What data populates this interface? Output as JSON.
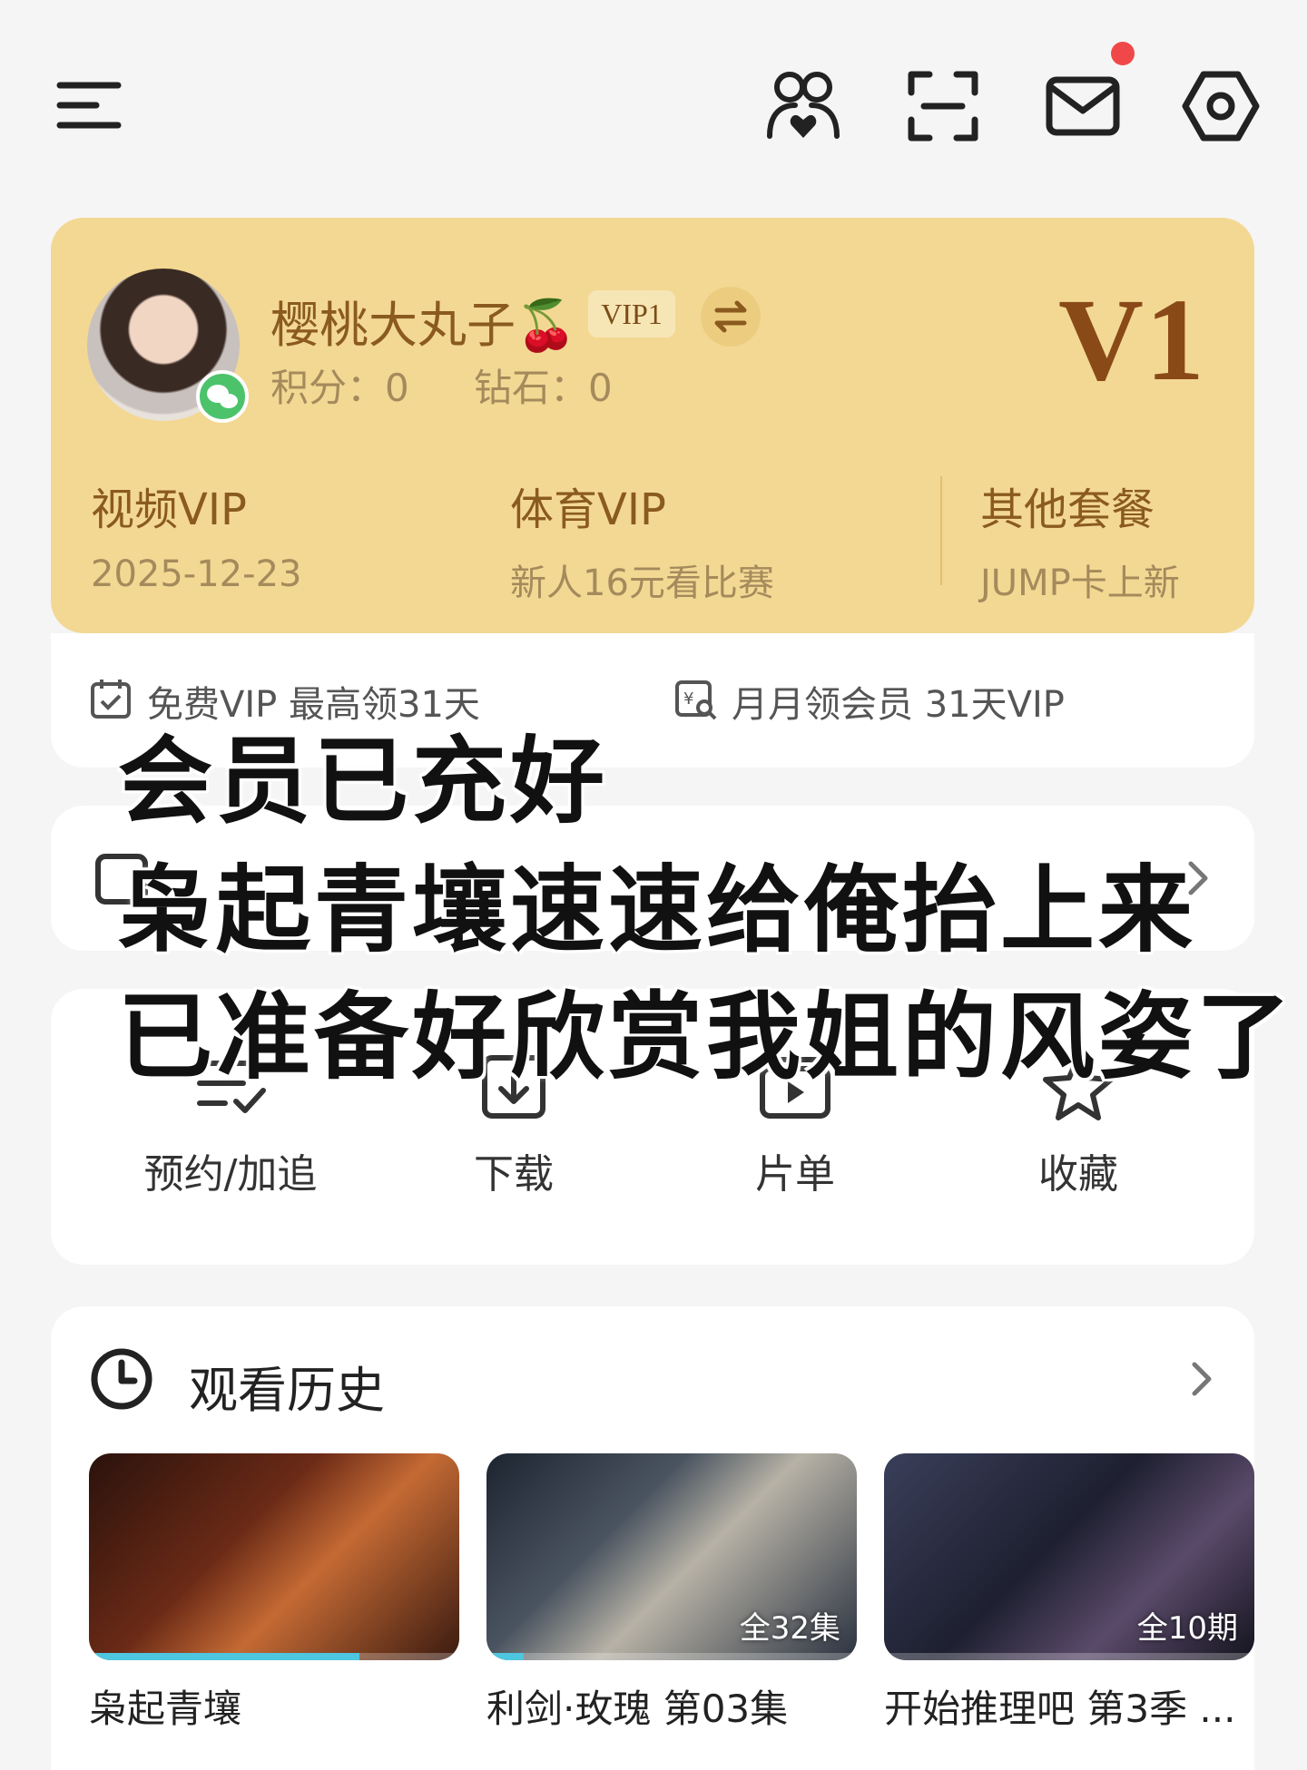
{
  "top_bar": {
    "icons": [
      "menu-icon",
      "family-icon",
      "scan-icon",
      "mail-icon",
      "settings-icon"
    ],
    "notification_dot": true,
    "accent_dot_color": "#f04848"
  },
  "vip_card": {
    "user_name": "樱桃大丸子🍒",
    "vip_tag": "VIP1",
    "points": "积分：0",
    "diamonds": "钻石：0",
    "level": "V1",
    "background_color": "#f3d893",
    "packages": [
      {
        "title": "视频VIP",
        "subtitle": "2025-12-23"
      },
      {
        "title": "体育VIP",
        "subtitle": "新人16元看比赛"
      },
      {
        "title": "其他套餐",
        "subtitle": "JUMP卡上新"
      }
    ]
  },
  "promos": [
    {
      "icon": "calendar-check-icon",
      "text": "免费VIP 最高领31天"
    },
    {
      "icon": "coupon-icon",
      "text": "月月领会员 31天VIP"
    }
  ],
  "actions": [
    {
      "icon": "reserve-list-icon",
      "label": "预约/加追"
    },
    {
      "icon": "download-icon",
      "label": "下载"
    },
    {
      "icon": "playlist-icon",
      "label": "片单"
    },
    {
      "icon": "star-icon",
      "label": "收藏"
    }
  ],
  "history": {
    "title": "观看历史",
    "items": [
      {
        "title": "枭起青壤",
        "tag": "",
        "progress": 0.73
      },
      {
        "title": "利剑·玫瑰 第03集",
        "tag": "全32集",
        "progress": 0.1
      },
      {
        "title": "开始推理吧 第3季 ...",
        "tag": "全10期",
        "progress": 0
      }
    ]
  },
  "overlay_caption": {
    "line1": "会员已充好",
    "line2": "枭起青壤速速给俺抬上来",
    "line3": "已准备好欣赏我姐的风姿了"
  }
}
